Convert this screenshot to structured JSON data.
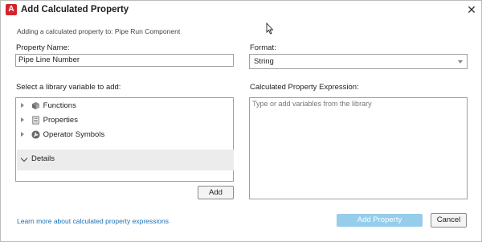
{
  "window": {
    "title": "Add Calculated Property",
    "close_glyph": "✕",
    "app_icon_letter": "A"
  },
  "subtitle": "Adding a calculated property to: Pipe Run Component",
  "property_name": {
    "label": "Property Name:",
    "value": "Pipe Line Number"
  },
  "format": {
    "label": "Format:",
    "selected": "String"
  },
  "library": {
    "label": "Select a library variable to add:",
    "items": [
      {
        "label": "Functions",
        "icon": "cube-icon"
      },
      {
        "label": "Properties",
        "icon": "list-icon"
      },
      {
        "label": "Operator Symbols",
        "icon": "wrench-icon"
      }
    ],
    "details_label": "Details",
    "add_button": "Add"
  },
  "expression": {
    "label": "Calculated Property Expression:",
    "placeholder": "Type or add variables from the library"
  },
  "footer": {
    "learn_more": "Learn more about calculated property expressions",
    "add_property": "Add Property",
    "cancel": "Cancel"
  },
  "colors": {
    "accent": "#d2262c",
    "primary_button": "#95cdea",
    "link": "#1a6fb3"
  }
}
